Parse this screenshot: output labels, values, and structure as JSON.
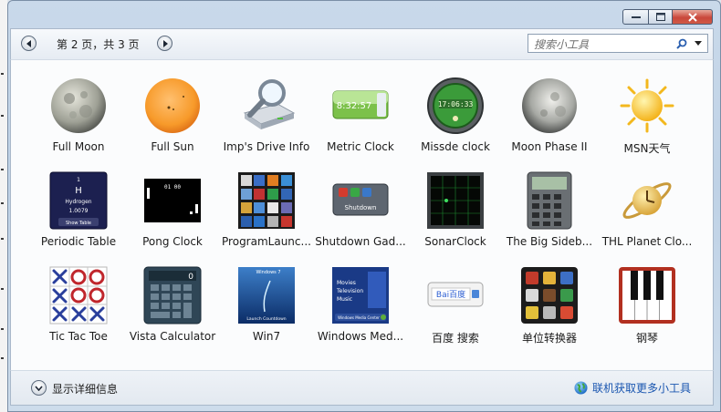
{
  "window": {
    "buttons": [
      "minimize",
      "maximize",
      "close"
    ]
  },
  "nav": {
    "page_text": "第 2 页，共 3 页",
    "search_placeholder": "搜索小工具"
  },
  "gadgets": [
    {
      "label": "Full Moon",
      "icon": "full-moon-icon"
    },
    {
      "label": "Full Sun",
      "icon": "full-sun-icon"
    },
    {
      "label": "Imp's Drive Info",
      "icon": "drive-magnifier-icon"
    },
    {
      "label": "Metric Clock",
      "icon": "metric-clock-icon",
      "icon_text": "8:32:57"
    },
    {
      "label": "Missde clock",
      "icon": "missde-clock-icon",
      "icon_text": "17:06:33"
    },
    {
      "label": "Moon Phase II",
      "icon": "moon-phase-icon"
    },
    {
      "label": "MSN天气",
      "icon": "msn-weather-sun-icon"
    },
    {
      "label": "Periodic Table",
      "icon": "periodic-table-icon",
      "icon_text": [
        "1",
        "H",
        "Hydrogen",
        "1.0079",
        "Show Table"
      ]
    },
    {
      "label": "Pong Clock",
      "icon": "pong-clock-icon",
      "icon_text": "01  00"
    },
    {
      "label": "ProgramLaunc...",
      "icon": "program-launcher-icon"
    },
    {
      "label": "Shutdown Gad...",
      "icon": "shutdown-gadget-icon",
      "icon_text": "Shutdown"
    },
    {
      "label": "SonarClock",
      "icon": "sonar-clock-icon"
    },
    {
      "label": "The Big Sideb...",
      "icon": "calculator-device-icon"
    },
    {
      "label": "THL Planet Clo...",
      "icon": "planet-clock-icon"
    },
    {
      "label": "Tic Tac Toe",
      "icon": "tic-tac-toe-icon"
    },
    {
      "label": "Vista Calculator",
      "icon": "vista-calculator-icon",
      "icon_text": "0"
    },
    {
      "label": "Win7",
      "icon": "win7-countdown-icon",
      "icon_text": [
        "Windows 7",
        "Launch Countdown"
      ]
    },
    {
      "label": "Windows Med...",
      "icon": "windows-media-center-icon",
      "icon_text": [
        "Movies",
        "Television",
        "Music",
        "Windows Media Center"
      ]
    },
    {
      "label": "百度 搜索",
      "icon": "baidu-search-icon",
      "icon_text": "Bai百度"
    },
    {
      "label": "单位转换器",
      "icon": "unit-converter-icon"
    },
    {
      "label": "钢琴",
      "icon": "piano-icon"
    }
  ],
  "footer": {
    "details_label": "显示详细信息",
    "online_label": "联机获取更多小工具"
  }
}
